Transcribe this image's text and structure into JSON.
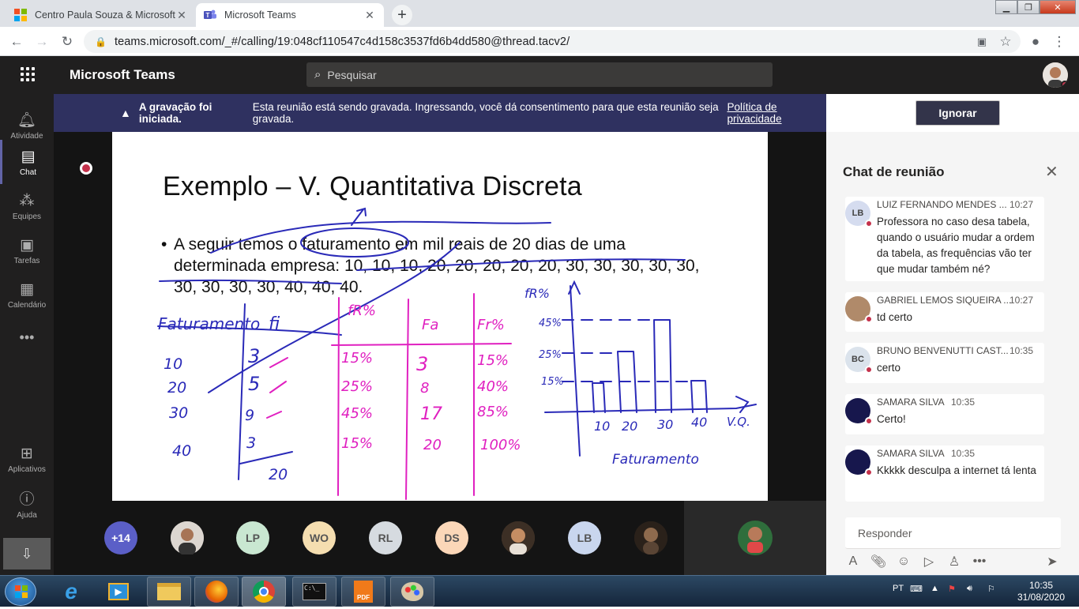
{
  "browser": {
    "tabs": [
      {
        "title": "Centro Paula Souza & Microsoft",
        "icon": "microsoft-logo-icon"
      },
      {
        "title": "Microsoft Teams",
        "icon": "teams-logo-icon"
      }
    ],
    "url": "teams.microsoft.com/_#/calling/19:048cf110547c4d158c3537fd6b4dd580@thread.tacv2/"
  },
  "teams": {
    "app_title": "Microsoft Teams",
    "search_placeholder": "Pesquisar"
  },
  "rail": [
    {
      "label": "Atividade",
      "icon": "bell-icon"
    },
    {
      "label": "Chat",
      "icon": "chat-icon"
    },
    {
      "label": "Equipes",
      "icon": "teams-icon"
    },
    {
      "label": "Tarefas",
      "icon": "assignments-icon"
    },
    {
      "label": "Calendário",
      "icon": "calendar-icon"
    },
    {
      "label": "Aplicativos",
      "icon": "apps-icon"
    },
    {
      "label": "Ajuda",
      "icon": "help-icon"
    }
  ],
  "banner": {
    "bold": "A gravação foi iniciada.",
    "text": "Esta reunião está sendo gravada. Ingressando, você dá consentimento para que esta reunião seja gravada.",
    "link": "Política de privacidade",
    "button": "Ignorar"
  },
  "slide": {
    "title": "Exemplo  – V. Quantitativa Discreta",
    "bullet": "A seguir temos o faturamento em mil reais de 20 dias de uma determinada empresa: 10, 10, 10, 20, 20, 20, 20, 20, 30, 30, 30, 30, 30, 30, 30, 30, 30, 40, 40, 40."
  },
  "participants": [
    "+14",
    "",
    "LP",
    "WO",
    "RL",
    "DS",
    "",
    "LB",
    ""
  ],
  "chat": {
    "title": "Chat de reunião",
    "messages": [
      {
        "initials": "LB",
        "name": "LUIZ FERNANDO MENDES ...",
        "time": "10:27",
        "text": "Professora no caso desa tabela, quando o usuário mudar a ordem da tabela, as frequências vão ter que mudar também né?"
      },
      {
        "initials": "",
        "name": "GABRIEL LEMOS SIQUEIRA ...",
        "time": "10:27",
        "text": "td certo"
      },
      {
        "initials": "BC",
        "name": "BRUNO BENVENUTTI CAST...",
        "time": "10:35",
        "text": "certo"
      },
      {
        "initials": "",
        "name": "SAMARA SILVA",
        "time": "10:35",
        "text": "Certo!"
      },
      {
        "initials": "",
        "name": "SAMARA SILVA",
        "time": "10:35",
        "text": "Kkkkk desculpa a internet tá lenta"
      }
    ],
    "reply_placeholder": "Responder"
  },
  "taskbar": {
    "language": "PT",
    "time": "10:35",
    "date": "31/08/2020"
  },
  "colors": {
    "teams_purple": "#6264a7",
    "banner": "#2f3160",
    "ink_blue": "#2a2ab8",
    "ink_magenta": "#e020c0"
  }
}
